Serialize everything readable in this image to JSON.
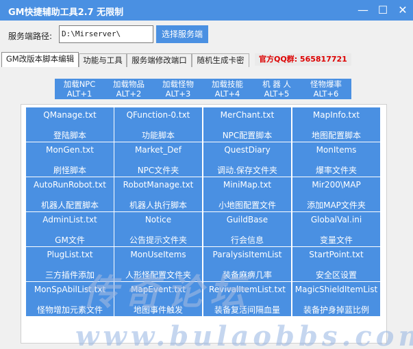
{
  "window": {
    "title": "GM快捷辅助工具2.7 无限制",
    "min": "—",
    "max": "☐",
    "close": "✕"
  },
  "server": {
    "label": "服务端路径:",
    "path": "D:\\Mirserver\\",
    "select_button": "选择服务端"
  },
  "tabs": [
    {
      "label": "GM改版本脚本编辑"
    },
    {
      "label": "功能与工具"
    },
    {
      "label": "服务端修改端口"
    },
    {
      "label": "随机生成卡密"
    }
  ],
  "qq_text": "官方QQ群: 565817721",
  "load_buttons": [
    {
      "line1": "加载NPC",
      "line2": "ALT+1"
    },
    {
      "line1": "加载物品",
      "line2": "ALT+2"
    },
    {
      "line1": "加载怪物",
      "line2": "ALT+3"
    },
    {
      "line1": "加载技能",
      "line2": "ALT+4"
    },
    {
      "line1": "机 器 人",
      "line2": "ALT+5"
    },
    {
      "line1": "怪物爆率",
      "line2": "ALT+6"
    }
  ],
  "grid": [
    [
      {
        "file": "QManage.txt",
        "desc": "登陆脚本"
      },
      {
        "file": "QFunction-0.txt",
        "desc": "功能脚本"
      },
      {
        "file": "MerChant.txt",
        "desc": "NPC配置脚本"
      },
      {
        "file": "MapInfo.txt",
        "desc": "地图配置脚本"
      }
    ],
    [
      {
        "file": "MonGen.txt",
        "desc": "刷怪脚本"
      },
      {
        "file": "Market_Def",
        "desc": "NPC文件夹"
      },
      {
        "file": "QuestDiary",
        "desc": "调动.保存文件夹"
      },
      {
        "file": "MonItems",
        "desc": "爆率文件夹"
      }
    ],
    [
      {
        "file": "AutoRunRobot.txt",
        "desc": "机器人配置脚本"
      },
      {
        "file": "RobotManage.txt",
        "desc": "机器人执行脚本"
      },
      {
        "file": "MiniMap.txt",
        "desc": "小地图配置文件"
      },
      {
        "file": "Mir200\\MAP",
        "desc": "添加MAP文件夹"
      }
    ],
    [
      {
        "file": "AdminList.txt",
        "desc": "GM文件"
      },
      {
        "file": "Notice",
        "desc": "公告提示文件夹"
      },
      {
        "file": "GuildBase",
        "desc": "行会信息"
      },
      {
        "file": "GlobalVal.ini",
        "desc": "变量文件"
      }
    ],
    [
      {
        "file": "PlugList.txt",
        "desc": "三方插件添加"
      },
      {
        "file": "MonUseItems",
        "desc": "人形怪配置文件夹"
      },
      {
        "file": "ParalysisItemList",
        "desc": "装备麻痹几率"
      },
      {
        "file": "StartPoint.txt",
        "desc": "安全区设置"
      }
    ],
    [
      {
        "file": "MonSpAbilList.txt",
        "desc": "怪物增加元素文件"
      },
      {
        "file": "MapEvent.txt",
        "desc": "地图事件触发"
      },
      {
        "file": "RevivalItemList.txt",
        "desc": "装备复活间隔血量"
      },
      {
        "file": "MagicShieldItemList",
        "desc": "装备护身掉蓝比例"
      }
    ]
  ],
  "watermark": {
    "logo_text": "传奇论坛",
    "url_text": "www.bulaobbs.com"
  }
}
